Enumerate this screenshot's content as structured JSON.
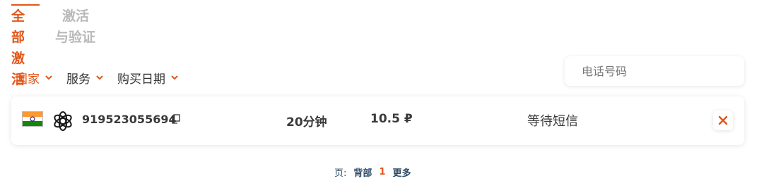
{
  "tabs": {
    "active": {
      "line1": "全部",
      "line2": "激活"
    },
    "inactive": {
      "line1": "激活",
      "line2": "与验证"
    }
  },
  "filters": [
    {
      "label": "国家",
      "active": true
    },
    {
      "label": "服务",
      "active": false
    },
    {
      "label": "购买日期",
      "active": false
    }
  ],
  "search": {
    "placeholder": "电话号码",
    "value": ""
  },
  "activation": {
    "country_icon": "india-flag-icon",
    "service_icon": "openai-icon",
    "phone": "919523055694",
    "duration": "20分钟",
    "price": "10.5 ₽",
    "status": "等待短信"
  },
  "pagination": {
    "label": "页:",
    "back": "背部",
    "current": "1",
    "more": "更多"
  },
  "colors": {
    "accent": "#e0561a",
    "muted": "#b9b9b9",
    "text": "#3a3a3a",
    "link": "#2d4a66"
  }
}
